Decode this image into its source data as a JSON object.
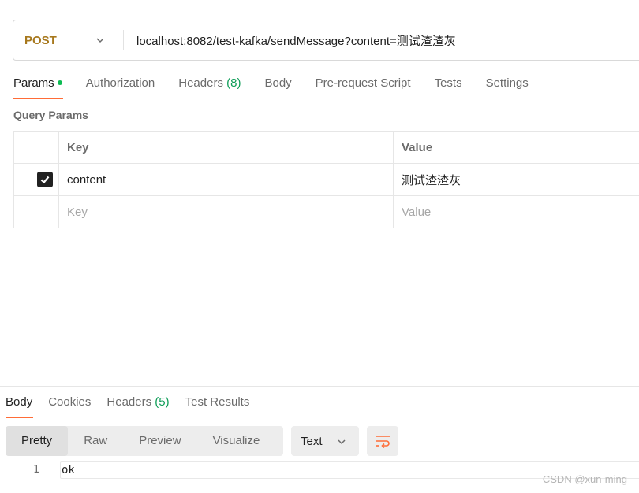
{
  "request": {
    "method": "POST",
    "url": "localhost:8082/test-kafka/sendMessage?content=测试渣渣灰"
  },
  "request_tabs": [
    {
      "label": "Params",
      "active": true
    },
    {
      "label": "Authorization"
    },
    {
      "label": "Headers",
      "count": "(8)"
    },
    {
      "label": "Body"
    },
    {
      "label": "Pre-request Script"
    },
    {
      "label": "Tests"
    },
    {
      "label": "Settings"
    }
  ],
  "query_params": {
    "title": "Query Params",
    "headers": {
      "key": "Key",
      "value": "Value"
    },
    "rows": [
      {
        "checked": true,
        "key": "content",
        "value": "测试渣渣灰"
      }
    ],
    "new_row": {
      "key_placeholder": "Key",
      "value_placeholder": "Value"
    }
  },
  "response_tabs": [
    {
      "label": "Body",
      "active": true
    },
    {
      "label": "Cookies"
    },
    {
      "label": "Headers",
      "count": "(5)"
    },
    {
      "label": "Test Results"
    }
  ],
  "response_view": {
    "modes": [
      "Pretty",
      "Raw",
      "Preview",
      "Visualize"
    ],
    "active_mode": "Pretty",
    "format": "Text",
    "body_lines": [
      {
        "number": "1",
        "text": "ok"
      }
    ]
  },
  "watermark": "CSDN @xun-ming",
  "colors": {
    "method": "#a7781d",
    "accent": "#ff6c37",
    "count": "#0f9d58",
    "dot": "#0cbb52"
  }
}
